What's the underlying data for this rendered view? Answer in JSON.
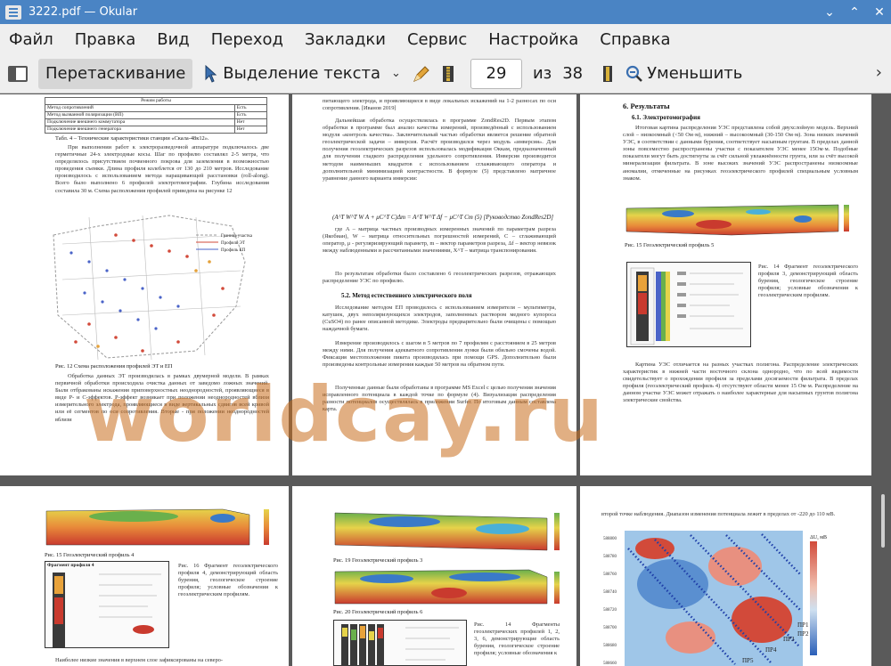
{
  "window": {
    "title": "3222.pdf  — Okular"
  },
  "menu": [
    "Файл",
    "Правка",
    "Вид",
    "Переход",
    "Закладки",
    "Сервис",
    "Настройка",
    "Справка"
  ],
  "toolbar": {
    "drag_label": "Перетаскивание",
    "select_label": "Выделение текста",
    "page_current": "29",
    "of_label": "из",
    "page_total": "38",
    "zoom_out_label": "Уменьшить"
  },
  "watermark": "worldcay.ru",
  "pages": {
    "p1": {
      "table_header": "Режим работы",
      "table_rows": [
        [
          "Метод сопротивлений",
          "Есть"
        ],
        [
          "Метод вызванной поляризации (ВП)",
          "Есть"
        ],
        [
          "Подключение внешнего коммутатора",
          "Нет"
        ],
        [
          "Подключение внешнего генератора",
          "Нет"
        ]
      ],
      "table_caption": "Табл. 4 – Технические характеристики станции «Скала-48к12».",
      "para1": "При выполнении работ к электроразведочной аппаратуре подключалось две герметичные 24-х электродные косы. Шаг по профилю составлял 2-5 метра, что определялось присутствием почвенного покрова для заземления в возможностью проведения съемки. Длина профиля колеблется от 130 до 210 метров. Исследование производилось с использованием метода наращивающей расстановки (roll-along). Всего было выполнено 6 профилей электротомографии. Глубина исследования составила 30 м. Схема расположения профилей приведена на рисунке 12",
      "legend": [
        "Граница участка",
        "Профиль ЭТ",
        "Профиль ЕП"
      ],
      "fig_caption": "Рис. 12 Схема расположения профилей ЭТ и ЕП",
      "para2": "Обработка данных ЭТ производилась в рамках двумерной модели. В рамках первичной обработки происходила очистка данных от заведомо ложных значений. Были отбракованы искажения приповерхностных неоднородностей, проявляющиеся в виде Р- и С-эффектов. Р-эффект возникает при положении неоднородностей вблизи измерительного электрода, проявляющиеся в виде вертикальных сдвигов всей кривой или её сегментов по оси сопротивления. Вторые - при положении неоднородностей вблизи"
    },
    "p2": {
      "para1": "питающего электрода, и проявляющиеся в виде локальных искажений на 1-2 разносах по оси сопротивления. [Иванов 2019]",
      "para2": "Дальнейшая обработка осуществлялась в программе ZondRes2D. Первым этапом обработки в программе был анализ качества измерений, произведённый с использованием модуля «контроль качества». Заключительный частью обработки является решение обратной геоэлектрической задачи – инверсия. Расчёт производился через модуль «инверсия». Для получения геоэлектрических разрезов использовалась модификация Оккам, предназначенный для получения гладкого распределения удельного сопротивления. Инверсия производится методом наименьших квадратов с использованием сглаживающего оператора и дополнительной минимизацией контрастности. В формуле (5) представлено матричное уравнение данного варианта инверсии:",
      "formula": "(A^T W^T W A + μC^T C)Δm = A^T W^T Δf − μC^T Cm  (5) [Руководство ZondRes2D]",
      "para3": "где A – матрица частных производных измеренных значений по параметрам разреза (Якобиан), W – матрица относительных погрешностей измерений, C – сглаживающий оператор, μ - регуляризирующий параметр, m – вектор параметров разреза, Δf – вектор невязок между наблюденными и рассчитанными значениями, X^T – матрица транспонирования.",
      "para4": "По результатам обработки было составлено 6 геоэлектрических разрезов, отражающих распределение УЭС по профилю.",
      "section": "5.2.      Метод естественного электрического поля",
      "para5": "Исследование методом ЕП проводилось с использованием измерителя – мультиметра, катушек, двух неполяризующихся электродов, заполненных раствором медного купороса (CuSO4) по ранее описанной методике. Электроды предварительно были очищены с помощью наждачной бумаги.",
      "para6": "Измерение производилось с шагом в 5 метров по 7 профилям с расстоянием в 25 метров между ними. Для получения адекватного сопротивления лунки были обильно смочены водой. Фиксация местоположения пикета производилась при помощи GPS. Дополнительно были произведены контрольные измерения каждые 50 метров на обратном пути.",
      "para7": "Полученные данные были обработаны в программе MS Excel с целью получения значения исправленного потенциала в каждой точке по формуле (4). Визуализация распределения разности потенциалов осуществлялась в приложении Surfer. По итоговым данным составлена карта."
    },
    "p3": {
      "heading": "6. Результаты",
      "subheading": "6.1.          Электротомография",
      "para1": "Итоговая картина распределения УЭС представлена собой двухслойную модель. Верхний слой – низкоомный (<50 Ом·м), нижний – высокоомный (30-150 Ом·м). Зона низких значений УЭС, в соответствии с данными бурения, соответствует насыпным грунтам. В пределах данной зоны повсеместно распространены участки с показателем УЭС менее 15Ом·м. Подобные показатели могут быть достигнуты за счёт сильной увлажнённости грунта, или за счёт высокой минерализации фильтрата. В зоне высоких значений УЭС распространены низкоомные аномалии, отмеченные на рисунках геоэлектрического профилей специальным условным знаком.",
      "fig15_caption": "Рис. 15 Геоэлектрический профиль 5",
      "fig14_text": "Рис. 14 Фрагмент геоэлектрического профиля 3, демонстрирующий область бурения, геологическое строение профиля; условные обозначения к геоэлектрическим профилям.",
      "para2": "Картина УЭС отличается на разных участках полигона. Распределение электрических характеристик в нижней части восточного склона однородно, что по всей видимости свидетельствует о прохождении профиля за пределами досягаемости фильтрата. В пределах профиля (геоэлектрический профиль 4) отсутствуют области менее 15 Ом·м. Распределение на данном участке УЭС может отражать о наиболее характерные для насыпных грунтов полигона электрические свойства."
    },
    "p4": {
      "fig15_caption": "Рис. 15 Геоэлектрический профиль 4",
      "fig16_text": "Рис. 16 Фрагмент геоэлектрического профиля 4, демонстрирующий область бурения, геологическое строение профиля; условные обозначения к геоэлектрическим профилям.",
      "frag_title": "Фрагмент профиля 4",
      "para1": "Наиболее низкие значения в верхнем слое зафиксированы на северо-"
    },
    "p5": {
      "fig19_caption": "Рис. 19 Геоэлектрический профиль 3",
      "fig20_caption": "Рис. 20 Геоэлектрический профиль 6",
      "fig14_text": "Рис. 14 Фрагменты геоэлектрических профилей 1, 2, 3, 6, демонстрирующие область бурения, геологическое строение профиля; условные обозначения к"
    },
    "p6": {
      "para1": "второй точке наблюдения. Диапазон изменения потенциала лежит в пределах от -220 до 110 мВ.",
      "map_unit": "ΔU, мВ",
      "map_labels": [
        "ПР1",
        "ПР2",
        "ПР3",
        "ПР4",
        "ПР5"
      ]
    }
  }
}
